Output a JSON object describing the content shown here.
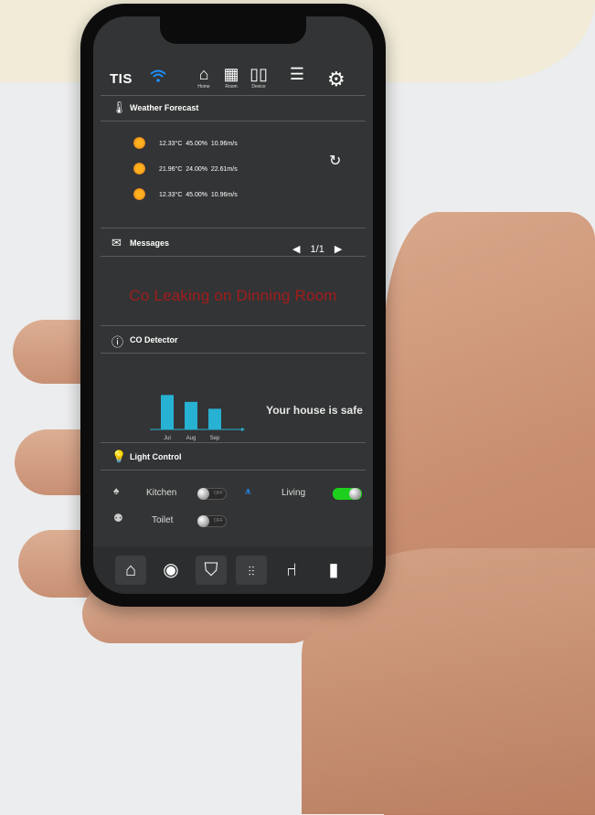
{
  "app": {
    "brand": "TIS"
  },
  "topnav": [
    {
      "label": "Home",
      "icon": "home-icon"
    },
    {
      "label": "Room",
      "icon": "grid-icon"
    },
    {
      "label": "Device",
      "icon": "device-icon"
    },
    {
      "label": "",
      "icon": "database-icon"
    },
    {
      "label": "",
      "icon": "gear-icon"
    }
  ],
  "weather": {
    "title": "Weather Forecast",
    "rows": [
      {
        "temp": "12.33°C",
        "humidity": "45.00%",
        "wind": "10.96m/s"
      },
      {
        "temp": "21.96°C",
        "humidity": "24.00%",
        "wind": "22.61m/s"
      },
      {
        "temp": "12.33°C",
        "humidity": "45.00%",
        "wind": "10.96m/s"
      }
    ]
  },
  "messages": {
    "title": "Messages",
    "page": "1/1",
    "text": "Co Leaking on Dinning Room"
  },
  "co": {
    "title": "CO Detector",
    "status": "Your house is safe"
  },
  "chart_data": {
    "type": "bar",
    "categories": [
      "Jul",
      "Aug",
      "Sep"
    ],
    "values": [
      3,
      2.4,
      1.8
    ],
    "ylim": [
      0,
      3.5
    ],
    "color": "#27b1d3"
  },
  "lights": {
    "title": "Light Control",
    "items": [
      {
        "name": "Kitchen",
        "state": "OFF",
        "on": false
      },
      {
        "name": "Living",
        "state": "ON",
        "on": true
      },
      {
        "name": "Toilet",
        "state": "OFF",
        "on": false
      }
    ]
  },
  "bottomnav": [
    "home-icon",
    "webcam-icon",
    "shield-icon",
    "equalizer-icon",
    "chair-icon",
    "door-icon"
  ],
  "colors": {
    "accent_blue": "#1e90ff",
    "alert_red": "#a21c1c",
    "toggle_on": "#1ed01e",
    "screen_bg": "#333435"
  }
}
